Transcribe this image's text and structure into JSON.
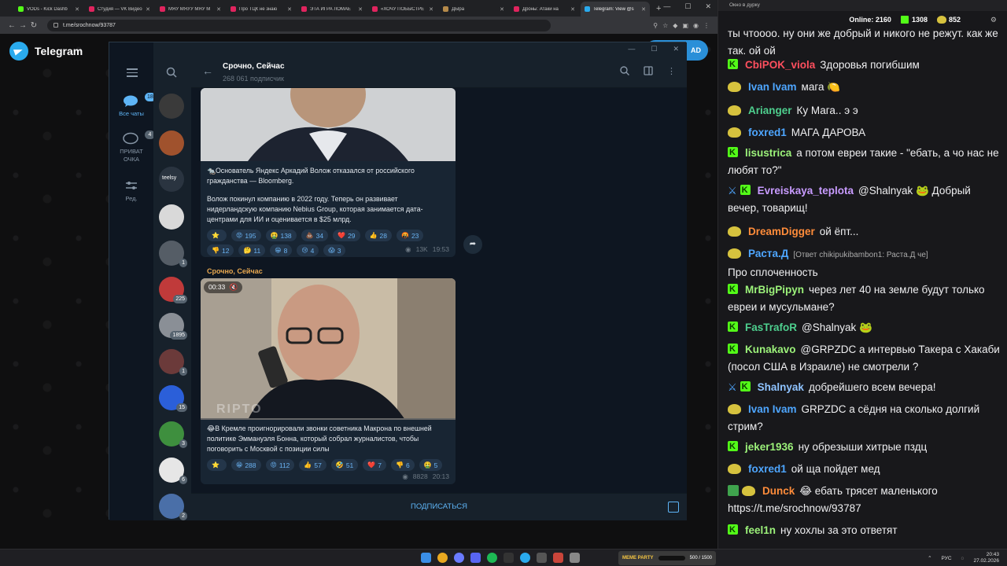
{
  "browser": {
    "tabs": [
      {
        "title": "VODs - Kick Dashb",
        "color": "#53fc18"
      },
      {
        "title": "Студия — VK Видео",
        "color": "#e0245e"
      },
      {
        "title": "МЯУ МЯУУ МЯУ М",
        "color": "#e0245e"
      },
      {
        "title": "Про ТЦК не знаю",
        "color": "#e0245e"
      },
      {
        "title": "ЭТА ИГРА ЛОМАЕ",
        "color": "#e0245e"
      },
      {
        "title": "«ХОЧУ ПОБЫСТРЕ",
        "color": "#e0245e"
      },
      {
        "title": "ДЫра",
        "color": "#b58a4a"
      },
      {
        "title": "Дроны: Атаки на",
        "color": "#e0245e"
      },
      {
        "title": "Telegram: View @s",
        "color": "#2aabee",
        "active": true
      }
    ],
    "new_tab": "+",
    "url": "t.me/srochnow/93787"
  },
  "tg_page": {
    "brand": "Telegram",
    "download_label": "AD"
  },
  "tg": {
    "folders": [
      {
        "label": "Все чаты",
        "badge": "18"
      },
      {
        "label": "ПРИВАТ ОЧКА",
        "badge": "4"
      },
      {
        "label": "Ред."
      }
    ],
    "chat_badges": [
      "",
      "",
      "",
      "",
      "1",
      "225",
      "1895",
      "1",
      "15",
      "3",
      "6",
      "2"
    ],
    "avatar_label": "teelsy",
    "channel": {
      "title": "Срочно, Сейчас",
      "subscribers": "268 061 подписчик"
    },
    "messages": [
      {
        "text1": "🐀Основатель Яндекс Аркадий Волож отказался от российского гражданства — Bloomberg.",
        "text2": "Волож покинул компанию в 2022 году. Теперь он развивает нидерландскую компанию Nebius Group, которая занимается дата-центрами для ИИ и оценивается в $25 млрд.",
        "reactions": [
          {
            "e": "⭐",
            "n": ""
          },
          {
            "e": "😡",
            "n": "195"
          },
          {
            "e": "🤮",
            "n": "138"
          },
          {
            "e": "💩",
            "n": "34"
          },
          {
            "e": "❤️",
            "n": "29"
          },
          {
            "e": "👍",
            "n": "28"
          },
          {
            "e": "🤬",
            "n": "23"
          },
          {
            "e": "👎",
            "n": "12"
          },
          {
            "e": "🤔",
            "n": "11"
          },
          {
            "e": "😁",
            "n": "8"
          },
          {
            "e": "😢",
            "n": "4"
          },
          {
            "e": "😱",
            "n": "3"
          }
        ],
        "views": "13K",
        "time": "19:53"
      },
      {
        "sender": "Срочно, Сейчас",
        "video_time": "00:33",
        "watermark": "RIPTO",
        "text": "😂В Кремле проигнорировали звонки советника Макрона по внешней политике Эммануэля Бонна, который собрал журналистов, чтобы поговорить с Москвой с позиции силы",
        "reactions": [
          {
            "e": "⭐",
            "n": ""
          },
          {
            "e": "😁",
            "n": "288"
          },
          {
            "e": "😡",
            "n": "112"
          },
          {
            "e": "👍",
            "n": "57"
          },
          {
            "e": "🤣",
            "n": "51"
          },
          {
            "e": "❤️",
            "n": "7"
          },
          {
            "e": "👎",
            "n": "6"
          },
          {
            "e": "🤮",
            "n": "5"
          }
        ],
        "views": "8828",
        "time": "20:13"
      }
    ],
    "subscribe_label": "ПОДПИСАТЬСЯ"
  },
  "chat": {
    "window_title": "Окно в дурку",
    "online_label": "Online:",
    "online": "2160",
    "kick_count": "1308",
    "emote_count": "852",
    "lines": [
      {
        "badges": "",
        "user": "",
        "color": "#efeff1",
        "text": "ты чтоооо. ну они же добрый и никого не режут. как же так. ой ой"
      },
      {
        "badges": "k",
        "user": "CbiPOK_viola",
        "color": "#ff4f5e",
        "text": "Здоровья погибшим"
      },
      {
        "badges": "p",
        "user": "Ivan Ivam",
        "color": "#4ea6ff",
        "text": "мага 🍋"
      },
      {
        "badges": "p",
        "user": "Arianger",
        "color": "#4ecf8e",
        "text": "Ку Мага.. э э"
      },
      {
        "badges": "p",
        "user": "foxred1",
        "color": "#4ea6ff",
        "text": "МАГА ДАРОВА"
      },
      {
        "badges": "k",
        "user": "lisustrica",
        "color": "#9cf27a",
        "text": "а потом евреи такие - \"ебать, а чо нас не любят то?\""
      },
      {
        "badges": "sk",
        "user": "Evreiskaya_teplota",
        "color": "#c89bff",
        "text": "@Shalnyak 🐸 Добрый вечер, товарищ!"
      },
      {
        "badges": "p",
        "user": "DreamDigger",
        "color": "#ff8c3a",
        "text": "ой ёпт..."
      },
      {
        "badges": "p",
        "user": "Раста.Д",
        "color": "#4ea6ff",
        "reply": "[Ответ chikipukibambon1: Раста.Д че]",
        "text": "Про сплоченность"
      },
      {
        "badges": "k",
        "user": "MrBigPipyn",
        "color": "#9cf27a",
        "text": "через лет 40 на земле будут только евреи и мусульмане?"
      },
      {
        "badges": "k",
        "user": "FasTrafoR",
        "color": "#4ecf8e",
        "text": "@Shalnyak 🐸"
      },
      {
        "badges": "k",
        "user": "Kunakavo",
        "color": "#9cf27a",
        "text": "@GRPZDC а интервью Такера с Хакаби (посол США в Израиле) не смотрели ?"
      },
      {
        "badges": "sk",
        "user": "Shalnyak",
        "color": "#8fc3ff",
        "text": "добрейшего всем вечера!"
      },
      {
        "badges": "p",
        "user": "Ivan Ivam",
        "color": "#4ea6ff",
        "text": "GRPZDC а сёдня на сколько долгий стрим?"
      },
      {
        "badges": "k",
        "user": "jeker1936",
        "color": "#9cf27a",
        "text": "ну обрезыши хитрые пздц"
      },
      {
        "badges": "p",
        "user": "foxred1",
        "color": "#4ea6ff",
        "text": "ой ща пойдет мед"
      },
      {
        "badges": "cp",
        "user": "Dunck",
        "color": "#ff8c3a",
        "text": "😂 ебать трясет маленького https://t.me/srochnow/93787"
      },
      {
        "badges": "k",
        "user": "feel1n",
        "color": "#9cf27a",
        "text": "ну хохлы за это ответят"
      }
    ]
  },
  "taskbar": {
    "overlay_title": "MEME PARTY",
    "overlay_count": "500 / 1500",
    "lang": "РУС",
    "time": "20:43",
    "date": "27.02.2026"
  }
}
